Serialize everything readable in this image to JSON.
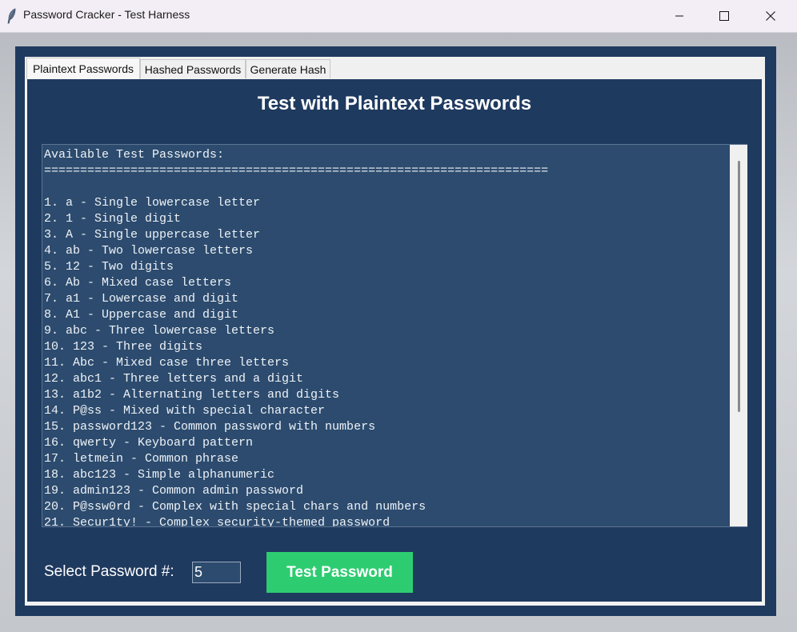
{
  "window": {
    "title": "Password Cracker - Test Harness",
    "app_icon": "feather-icon",
    "controls": [
      "minimize-icon",
      "maximize-icon",
      "close-icon"
    ]
  },
  "tabs": [
    {
      "label": "Plaintext Passwords",
      "active": true
    },
    {
      "label": "Hashed Passwords",
      "active": false
    },
    {
      "label": "Generate Hash",
      "active": false
    }
  ],
  "panel": {
    "title": "Test with Plaintext Passwords",
    "text_lines": [
      "Available Test Passwords:",
      "======================================================================",
      "",
      "1. a - Single lowercase letter",
      "2. 1 - Single digit",
      "3. A - Single uppercase letter",
      "4. ab - Two lowercase letters",
      "5. 12 - Two digits",
      "6. Ab - Mixed case letters",
      "7. a1 - Lowercase and digit",
      "8. A1 - Uppercase and digit",
      "9. abc - Three lowercase letters",
      "10. 123 - Three digits",
      "11. Abc - Mixed case three letters",
      "12. abc1 - Three letters and a digit",
      "13. a1b2 - Alternating letters and digits",
      "14. P@ss - Mixed with special character",
      "15. password123 - Common password with numbers",
      "16. qwerty - Keyboard pattern",
      "17. letmein - Common phrase",
      "18. abc123 - Simple alphanumeric",
      "19. admin123 - Common admin password",
      "20. P@ssw0rd - Complex with special chars and numbers",
      "21. Secur1ty! - Complex security-themed password"
    ]
  },
  "select": {
    "label": "Select Password #:",
    "value": "5"
  },
  "test_button": {
    "label": "Test Password"
  },
  "colors": {
    "panel_bg": "#1f3a5f",
    "textarea_bg": "#2c4b6e",
    "button_bg": "#2ecc71",
    "text": "#ffffff"
  }
}
